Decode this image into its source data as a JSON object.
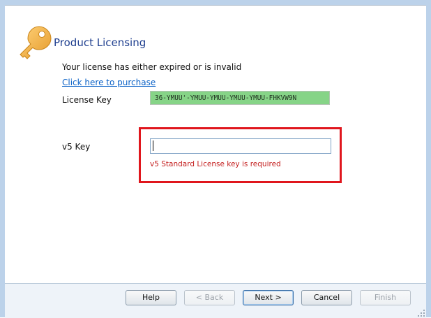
{
  "header": {
    "title": "Product Licensing"
  },
  "main": {
    "subtitle": "Your license has either expired or is invalid",
    "purchase_link": "Click here to purchase",
    "license_key_label": "License Key",
    "license_key_value": "36-YMUU'-YMUU-YMUU-YMUU-YMUU-FHKVW9N",
    "v5_key_label": "v5 Key",
    "v5_key_value": "",
    "v5_key_placeholder": "",
    "v5_error": "v5 Standard License key is required"
  },
  "buttons": {
    "help": "Help",
    "back": "< Back",
    "next": "Next >",
    "cancel": "Cancel",
    "finish": "Finish"
  },
  "colors": {
    "title": "#1f3f8f",
    "link": "#0b62c7",
    "license_key_bg": "#86d487",
    "error": "#c41e1e",
    "highlight_box": "#e0161d"
  },
  "icons": {
    "header_icon": "key-icon",
    "resize": "resize-grip-icon"
  }
}
